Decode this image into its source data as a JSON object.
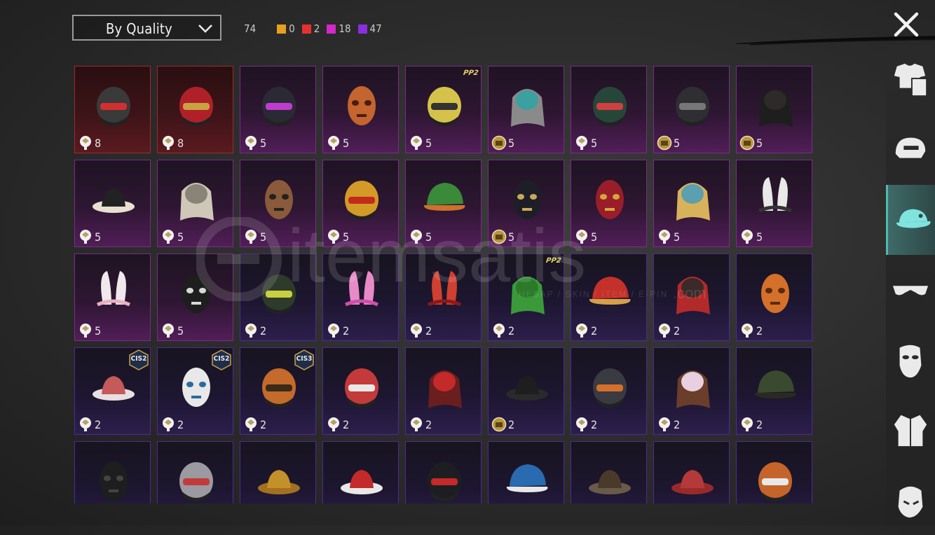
{
  "sort": {
    "label": "By Quality"
  },
  "counts": {
    "total": "74",
    "qualities": [
      {
        "color": "#e8a020",
        "value": "0"
      },
      {
        "color": "#e83030",
        "value": "2"
      },
      {
        "color": "#d428c8",
        "value": "18"
      },
      {
        "color": "#8a2ee0",
        "value": "47"
      }
    ]
  },
  "watermark": {
    "brand": "itemsatis",
    "tagline": "HESAP / SKIN / ITEM / E-PIN",
    "suffix": ".com"
  },
  "grid": {
    "rows": [
      [
        {
          "q": "red",
          "count": "8",
          "src": "crate",
          "icon": "oni-mask-helmet"
        },
        {
          "q": "red",
          "count": "8",
          "src": "crate",
          "icon": "red-visor-helmet"
        },
        {
          "q": "pink",
          "count": "5",
          "src": "crate",
          "icon": "neon-punk-helmet"
        },
        {
          "q": "pink",
          "count": "5",
          "src": "crate",
          "icon": "horned-dragon-helmet"
        },
        {
          "q": "pink",
          "count": "5",
          "src": "crate",
          "icon": "yellow-knight-helmet",
          "sticker": "PP2"
        },
        {
          "q": "pink",
          "count": "5",
          "src": "coin",
          "icon": "ponytail-visor-helmet"
        },
        {
          "q": "pink",
          "count": "5",
          "src": "crate",
          "icon": "green-alien-helmet"
        },
        {
          "q": "pink",
          "count": "5",
          "src": "coin",
          "icon": "kendo-helmet"
        },
        {
          "q": "pink",
          "count": "5",
          "src": "coin",
          "icon": "black-hair-bun"
        }
      ],
      [
        {
          "q": "pink",
          "count": "5",
          "src": "crate",
          "icon": "piano-hat"
        },
        {
          "q": "pink",
          "count": "5",
          "src": "crate",
          "icon": "lion-mane-mask"
        },
        {
          "q": "pink",
          "count": "5",
          "src": "crate",
          "icon": "officer-bunny-mask"
        },
        {
          "q": "pink",
          "count": "5",
          "src": "crate",
          "icon": "rooster-helmet"
        },
        {
          "q": "pink",
          "count": "5",
          "src": "crate",
          "icon": "frog-cap"
        },
        {
          "q": "pink",
          "count": "5",
          "src": "coin",
          "icon": "black-panther-mask"
        },
        {
          "q": "pink",
          "count": "5",
          "src": "crate",
          "icon": "luchador-mask"
        },
        {
          "q": "pink",
          "count": "5",
          "src": "crate",
          "icon": "feather-headdress"
        },
        {
          "q": "pink",
          "count": "5",
          "src": "crate",
          "icon": "bunny-ears-headband"
        }
      ],
      [
        {
          "q": "pink",
          "count": "5",
          "src": "crate",
          "icon": "white-bunny-ears"
        },
        {
          "q": "pink",
          "count": "5",
          "src": "crate",
          "icon": "skull-balaclava"
        },
        {
          "q": "purple",
          "count": "2",
          "src": "crate",
          "icon": "gas-mask-helmet"
        },
        {
          "q": "purple",
          "count": "2",
          "src": "crate",
          "icon": "pink-bunny-goggles"
        },
        {
          "q": "purple",
          "count": "2",
          "src": "crate",
          "icon": "devil-horns"
        },
        {
          "q": "purple",
          "count": "2",
          "src": "crate",
          "icon": "green-hair",
          "sticker": "PP2"
        },
        {
          "q": "purple",
          "count": "2",
          "src": "crate",
          "icon": "red-gold-cap"
        },
        {
          "q": "purple",
          "count": "2",
          "src": "crate",
          "icon": "red-hair-hood"
        },
        {
          "q": "purple",
          "count": "2",
          "src": "crate",
          "icon": "pumpkin-mask"
        }
      ],
      [
        {
          "q": "purple",
          "count": "2",
          "src": "crate",
          "icon": "striped-beanie",
          "badge": "CIS2"
        },
        {
          "q": "purple",
          "count": "2",
          "src": "crate",
          "icon": "chef-gas-mask",
          "badge": "CIS2"
        },
        {
          "q": "purple",
          "count": "2",
          "src": "crate",
          "icon": "orange-lantern-helmet",
          "badge": "CIS3"
        },
        {
          "q": "purple",
          "count": "2",
          "src": "crate",
          "icon": "football-helmet"
        },
        {
          "q": "purple",
          "count": "2",
          "src": "crate",
          "icon": "bow-red-hair"
        },
        {
          "q": "purple",
          "count": "2",
          "src": "coin",
          "icon": "black-flat-hat"
        },
        {
          "q": "purple",
          "count": "2",
          "src": "crate",
          "icon": "tribal-helmet"
        },
        {
          "q": "purple",
          "count": "2",
          "src": "crate",
          "icon": "flower-brown-hair"
        },
        {
          "q": "purple",
          "count": "2",
          "src": "crate",
          "icon": "military-cap"
        }
      ],
      [
        {
          "q": "purple",
          "count": "",
          "src": "",
          "icon": "black-gas-mask"
        },
        {
          "q": "purple",
          "count": "",
          "src": "",
          "icon": "goggle-helmet"
        },
        {
          "q": "purple",
          "count": "",
          "src": "",
          "icon": "yellow-beanie"
        },
        {
          "q": "purple",
          "count": "",
          "src": "",
          "icon": "mushroom-hat"
        },
        {
          "q": "purple",
          "count": "",
          "src": "",
          "icon": "black-moto-helmet"
        },
        {
          "q": "purple",
          "count": "",
          "src": "",
          "icon": "blue-pom-beanie"
        },
        {
          "q": "purple",
          "count": "",
          "src": "",
          "icon": "aviator-cap"
        },
        {
          "q": "purple",
          "count": "",
          "src": "",
          "icon": "red-beanie"
        },
        {
          "q": "purple",
          "count": "",
          "src": "",
          "icon": "orange-football-helmet"
        }
      ]
    ]
  },
  "sidebar": {
    "categories": [
      {
        "icon": "outfit-icon",
        "active": false
      },
      {
        "icon": "helmet-icon",
        "active": false
      },
      {
        "icon": "cap-icon",
        "active": true
      },
      {
        "icon": "glasses-icon",
        "active": false
      },
      {
        "icon": "mask-icon",
        "active": false
      },
      {
        "icon": "jacket-icon",
        "active": false
      },
      {
        "icon": "face-icon",
        "active": false
      }
    ]
  }
}
